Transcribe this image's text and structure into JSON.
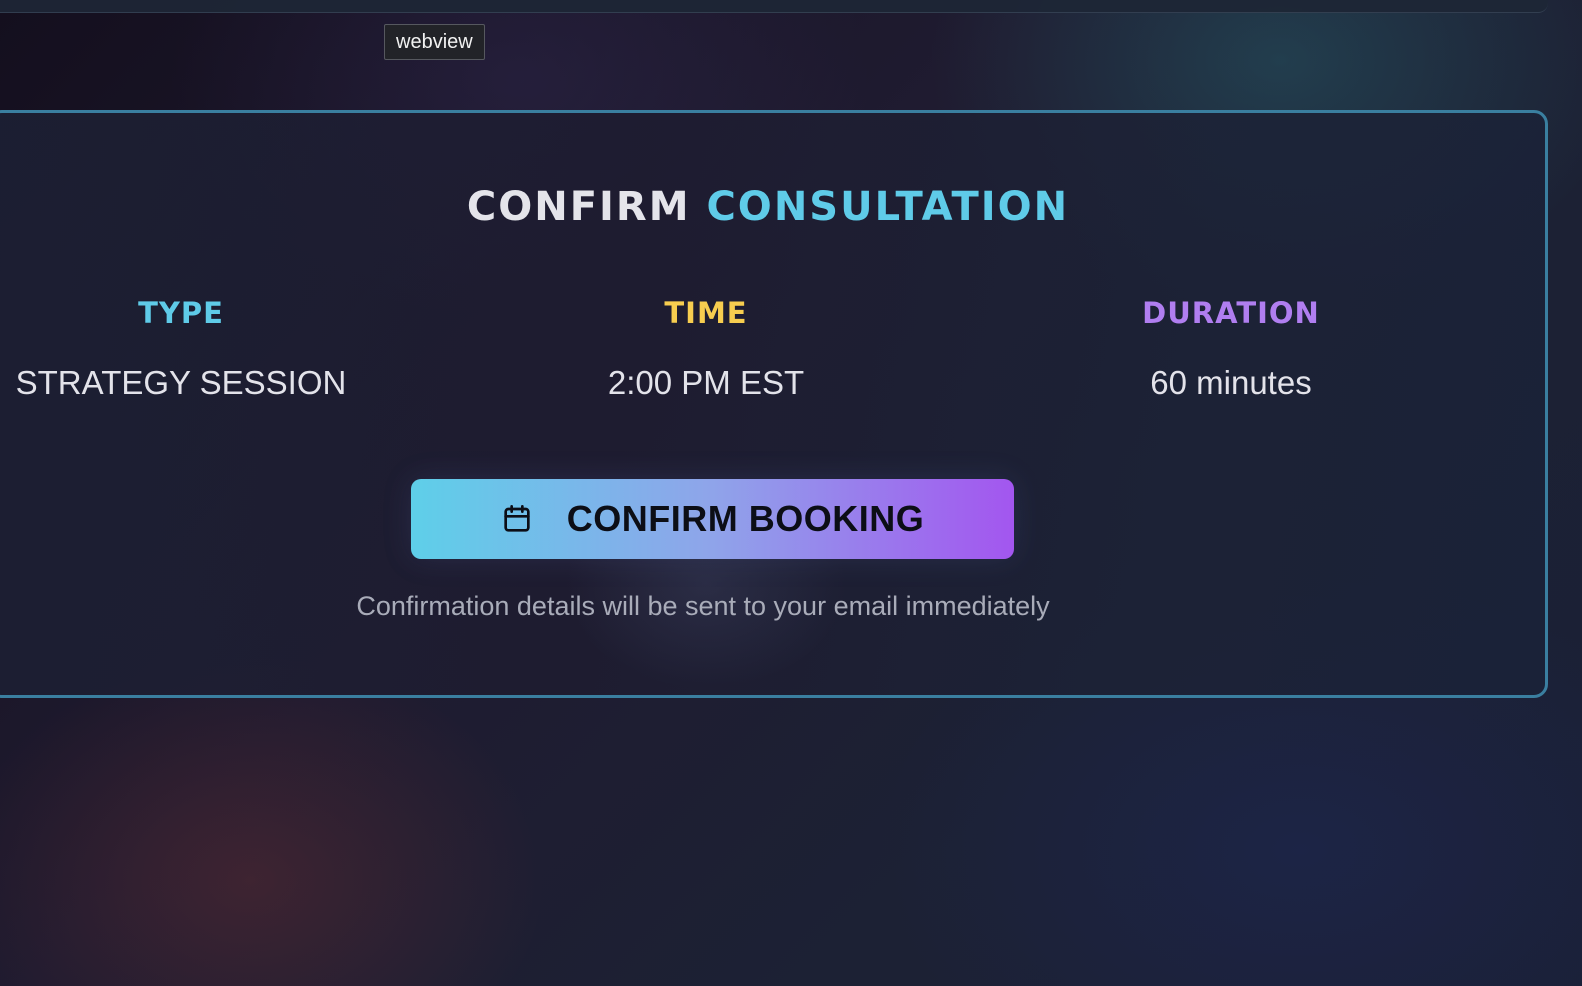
{
  "tooltip": {
    "text": "webview"
  },
  "card": {
    "title_part1": "CONFIRM",
    "title_part2": "CONSULTATION",
    "details": [
      {
        "label": "TYPE",
        "value": "STRATEGY SESSION",
        "color": "#5fcbe8"
      },
      {
        "label": "TIME",
        "value": "2:00 PM EST",
        "color": "#f7cd4f"
      },
      {
        "label": "DURATION",
        "value": "60 minutes",
        "color": "#b07ef0"
      }
    ],
    "button": {
      "label": "CONFIRM BOOKING",
      "icon": "calendar-icon"
    },
    "note": "Confirmation details will be sent to your email immediately"
  },
  "colors": {
    "accent_cyan": "#5fcbe8",
    "accent_yellow": "#f7cd4f",
    "accent_purple": "#b07ef0",
    "card_border": "#3a7fa0",
    "button_gradient_start": "#5ecfe9",
    "button_gradient_end": "#a356ef"
  }
}
